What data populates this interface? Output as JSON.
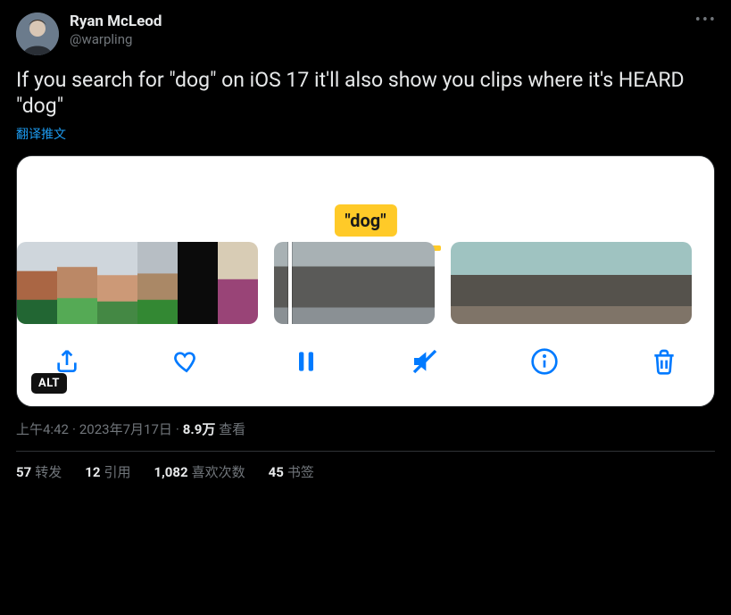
{
  "author": {
    "display_name": "Ryan McLeod",
    "handle": "@warpling"
  },
  "tweet_text": "If you search for \"dog\" on iOS 17 it'll also show you clips where it's HEARD \"dog\"",
  "translate_label": "翻译推文",
  "media": {
    "search_term_label": "\"dog\"",
    "alt_badge": "ALT"
  },
  "meta": {
    "time": "上午4:42",
    "date": "2023年7月17日",
    "view_count": "8.9万",
    "view_label": "查看"
  },
  "stats": {
    "retweets": {
      "count": "57",
      "label": "转发"
    },
    "quotes": {
      "count": "12",
      "label": "引用"
    },
    "likes": {
      "count": "1,082",
      "label": "喜欢次数"
    },
    "bookmarks": {
      "count": "45",
      "label": "书签"
    }
  }
}
